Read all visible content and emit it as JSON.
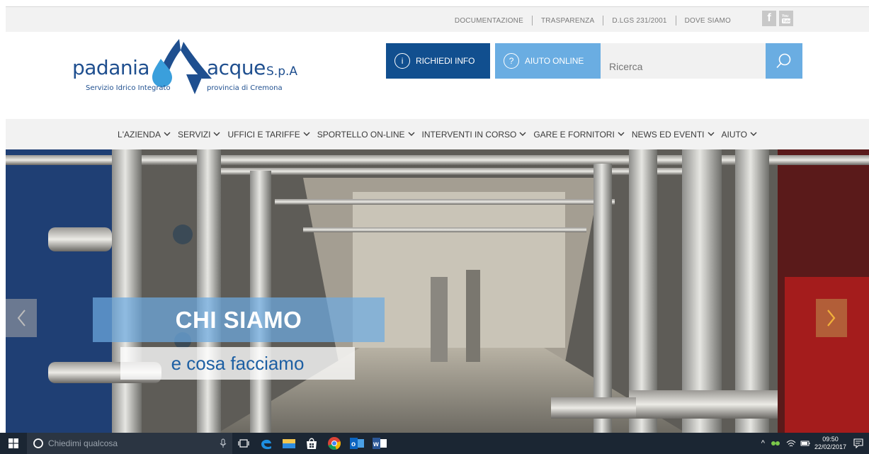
{
  "topbar": {
    "links": [
      "DOCUMENTAZIONE",
      "TRASPARENZA",
      "D.LGS 231/2001",
      "DOVE SIAMO"
    ],
    "social": [
      "facebook-icon",
      "youtube-icon"
    ]
  },
  "logo": {
    "word_left": "padania",
    "word_right": "acque",
    "suffix": "S.p.A",
    "tag_left": "Servizio Idrico Integrato",
    "tag_right": "provincia di Cremona",
    "colors": {
      "dark_blue": "#1f4f8f",
      "light_blue": "#3a9fdc"
    }
  },
  "header": {
    "info_button": "RICHIEDI INFO",
    "help_button": "AIUTO ONLINE",
    "search_placeholder": "Ricerca",
    "colors": {
      "info_bg": "#114f8f",
      "help_bg": "#6aade2"
    }
  },
  "nav": {
    "items": [
      "L'AZIENDA",
      "SERVIZI",
      "UFFICI E TARIFFE",
      "SPORTELLO ON-LINE",
      "INTERVENTI IN CORSO",
      "GARE E FORNITORI",
      "NEWS ED EVENTI",
      "AIUTO"
    ]
  },
  "hero": {
    "title": "CHI SIAMO",
    "subtitle": "e cosa facciamo"
  },
  "taskbar": {
    "search_text": "Chiedimi qualcosa",
    "time": "09:50",
    "date": "22/02/2017",
    "apps": [
      "microphone-icon",
      "task-view-icon",
      "edge-icon",
      "file-explorer-icon",
      "store-icon",
      "chrome-icon",
      "outlook-icon",
      "word-icon"
    ]
  }
}
